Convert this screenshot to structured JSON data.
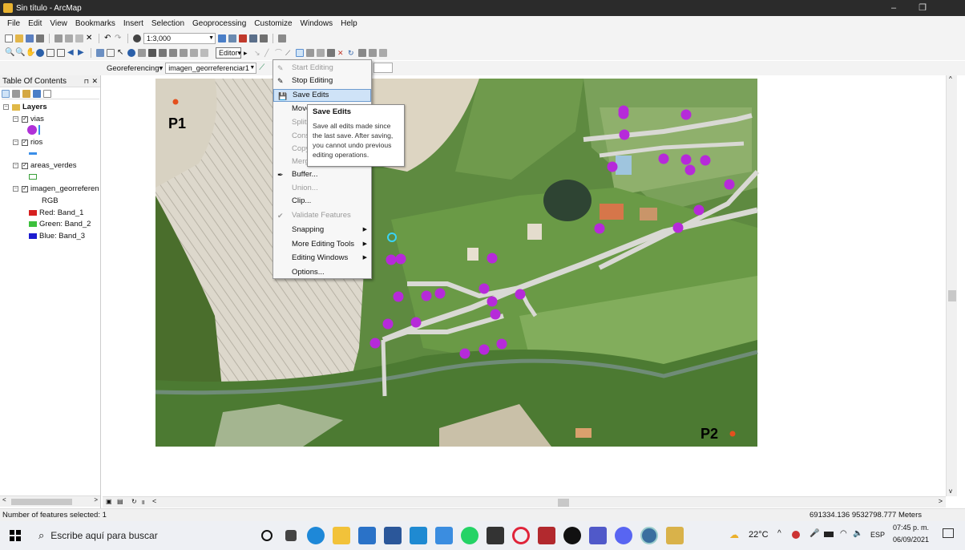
{
  "window": {
    "title": "Sin título - ArcMap"
  },
  "menubar": [
    "File",
    "Edit",
    "View",
    "Bookmarks",
    "Insert",
    "Selection",
    "Geoprocessing",
    "Customize",
    "Windows",
    "Help"
  ],
  "toolbar": {
    "scale": "1:3,000",
    "editor_label": "Editor▾",
    "georef_label": "Georeferencing▾",
    "georef_layer": "imagen_georreferenciar1"
  },
  "toc": {
    "title": "Table Of Contents",
    "root": "Layers",
    "layers": [
      "vias",
      "rios",
      "areas_verdes",
      "imagen_georreferen"
    ],
    "rgb_label": "RGB",
    "bands": [
      "Red:  Band_1",
      "Green: Band_2",
      "Blue:  Band_3"
    ],
    "colors": {
      "red": "#d62020",
      "green": "#3cc03c",
      "blue": "#1c1cd0",
      "vias": "#b030d8",
      "rios": "#3a8ee8",
      "areas": "#7bc67b"
    }
  },
  "editor_menu": {
    "items": [
      {
        "label": "Start Editing",
        "disabled": true
      },
      {
        "label": "Stop Editing",
        "disabled": false
      },
      {
        "label": "Save Edits",
        "disabled": false,
        "highlight": true
      },
      {
        "label": "Move...",
        "disabled": false
      },
      {
        "label": "Split...",
        "disabled": true
      },
      {
        "label": "Construct...",
        "disabled": true
      },
      {
        "label": "Copy...",
        "disabled": true
      },
      {
        "label": "Merge...",
        "disabled": true
      },
      {
        "label": "Buffer...",
        "disabled": false
      },
      {
        "label": "Union...",
        "disabled": true
      },
      {
        "label": "Clip...",
        "disabled": false
      },
      {
        "label": "Validate Features",
        "disabled": true
      },
      {
        "label": "Snapping",
        "disabled": false,
        "submenu": true
      },
      {
        "label": "More Editing Tools",
        "disabled": false,
        "submenu": true
      },
      {
        "label": "Editing Windows",
        "disabled": false,
        "submenu": true
      },
      {
        "label": "Options...",
        "disabled": false
      }
    ]
  },
  "tooltip": {
    "title": "Save Edits",
    "body": "Save all edits made since the last save. After saving, you cannot undo previous editing operations."
  },
  "map": {
    "label_p1": "P1",
    "label_p2": "P2",
    "point_color": "#b62ad9",
    "marker_color": "#e4501e"
  },
  "status": {
    "selected": "Number of features selected: 1",
    "coords": "691334.136  9532798.777 Meters"
  },
  "taskbar": {
    "search_placeholder": "Escribe aquí para buscar",
    "weather": "22°C",
    "lang": "ESP",
    "time": "07:45 p. m.",
    "date": "06/09/2021"
  }
}
